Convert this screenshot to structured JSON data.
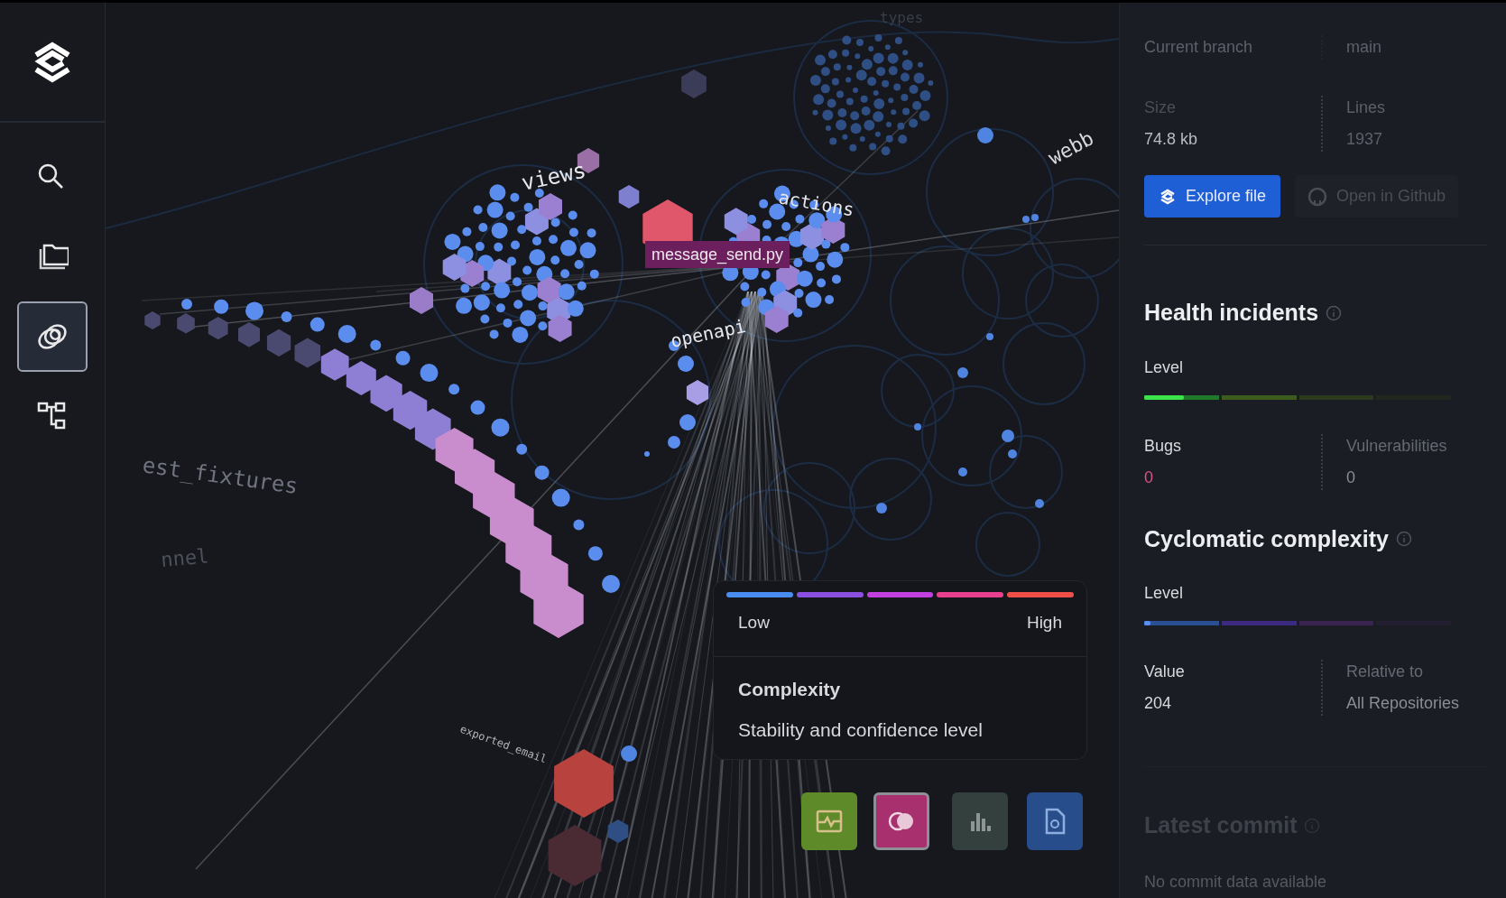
{
  "sidebar": {
    "items": [
      {
        "kind": "search",
        "selected": false
      },
      {
        "kind": "folder",
        "selected": false
      },
      {
        "kind": "rings",
        "selected": true
      },
      {
        "kind": "hierarchy",
        "selected": false
      }
    ]
  },
  "graph": {
    "labels": [
      {
        "text": "types"
      },
      {
        "text": "views"
      },
      {
        "text": "actions"
      },
      {
        "text": "webb"
      },
      {
        "text": "openapi"
      },
      {
        "text": "est_fixtures"
      },
      {
        "text": "nnel"
      },
      {
        "text": "exported_email"
      }
    ],
    "selected_file": "message_send.py"
  },
  "legend": {
    "segments": [
      {
        "color": "#4a8df0"
      },
      {
        "color": "#8b4fe0"
      },
      {
        "color": "#c23fe0"
      },
      {
        "color": "#e8408f"
      },
      {
        "color": "#ee4f48"
      }
    ],
    "low": "Low",
    "high": "High",
    "title": "Complexity",
    "description": "Stability and confidence level"
  },
  "toolbar": [
    {
      "kind": "pulse",
      "color": "#5f8a2a",
      "selected": false
    },
    {
      "kind": "rings",
      "color": "#a8306e",
      "selected": true
    },
    {
      "kind": "bars",
      "color": "#34403e",
      "selected": false
    },
    {
      "kind": "file",
      "color": "#274d8a",
      "selected": false
    }
  ],
  "panel": {
    "branch": {
      "label": "Current branch",
      "value": "main"
    },
    "stats": [
      {
        "label": "Size",
        "value": "74.8 kb"
      },
      {
        "label": "Lines",
        "value": "1937"
      }
    ],
    "buttons": [
      {
        "kind": "primary",
        "label": "Explore file"
      },
      {
        "kind": "github",
        "label": "Open in Github"
      }
    ],
    "health": {
      "title": "Health incidents",
      "level_label": "Level",
      "level": 0.13,
      "stats": [
        {
          "label": "Bugs",
          "value": "0",
          "alert": true
        },
        {
          "label": "Vulnerabilities",
          "value": "0",
          "alert": false
        }
      ]
    },
    "complexity": {
      "title": "Cyclomatic complexity",
      "level_label": "Level",
      "level": 0.02,
      "stats": [
        {
          "label": "Value",
          "value": "204",
          "alert": false
        },
        {
          "label": "Relative to",
          "value": "All Repositories",
          "alert": false
        }
      ]
    },
    "commit": {
      "title": "Latest commit",
      "message": "No commit data available"
    }
  }
}
